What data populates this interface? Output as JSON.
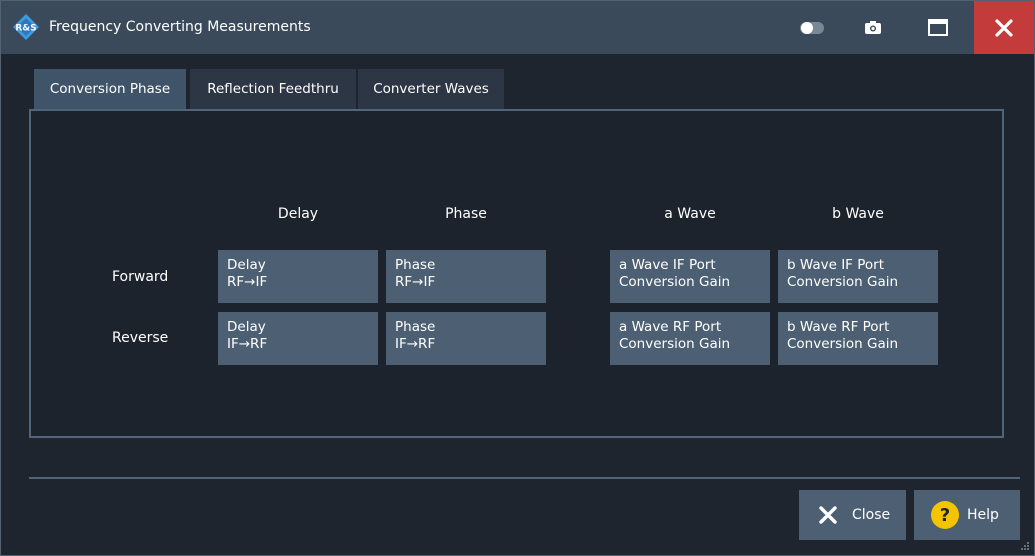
{
  "window": {
    "title": "Frequency Converting Measurements"
  },
  "tabs": [
    {
      "label": "Conversion Phase",
      "active": true
    },
    {
      "label": "Reflection Feedthru",
      "active": false
    },
    {
      "label": "Converter Waves",
      "active": false
    }
  ],
  "grid": {
    "columns": [
      "Delay",
      "Phase",
      "a Wave",
      "b Wave"
    ],
    "rows": [
      {
        "label": "Forward",
        "cells": [
          {
            "line1": "Delay",
            "line2": "RF→IF"
          },
          {
            "line1": "Phase",
            "line2": "RF→IF"
          },
          {
            "line1": "a Wave IF Port",
            "line2": "Conversion Gain"
          },
          {
            "line1": "b Wave IF Port",
            "line2": "Conversion Gain"
          }
        ]
      },
      {
        "label": "Reverse",
        "cells": [
          {
            "line1": "Delay",
            "line2": "IF→RF"
          },
          {
            "line1": "Phase",
            "line2": "IF→RF"
          },
          {
            "line1": "a Wave RF Port",
            "line2": "Conversion Gain"
          },
          {
            "line1": "b Wave RF Port",
            "line2": "Conversion Gain"
          }
        ]
      }
    ]
  },
  "footer": {
    "close_label": "Close",
    "help_label": "Help"
  },
  "colors": {
    "titlebar": "#3a4a5b",
    "close_red": "#c43b3b",
    "cell": "#4d6073",
    "help_yellow": "#f5c400"
  }
}
